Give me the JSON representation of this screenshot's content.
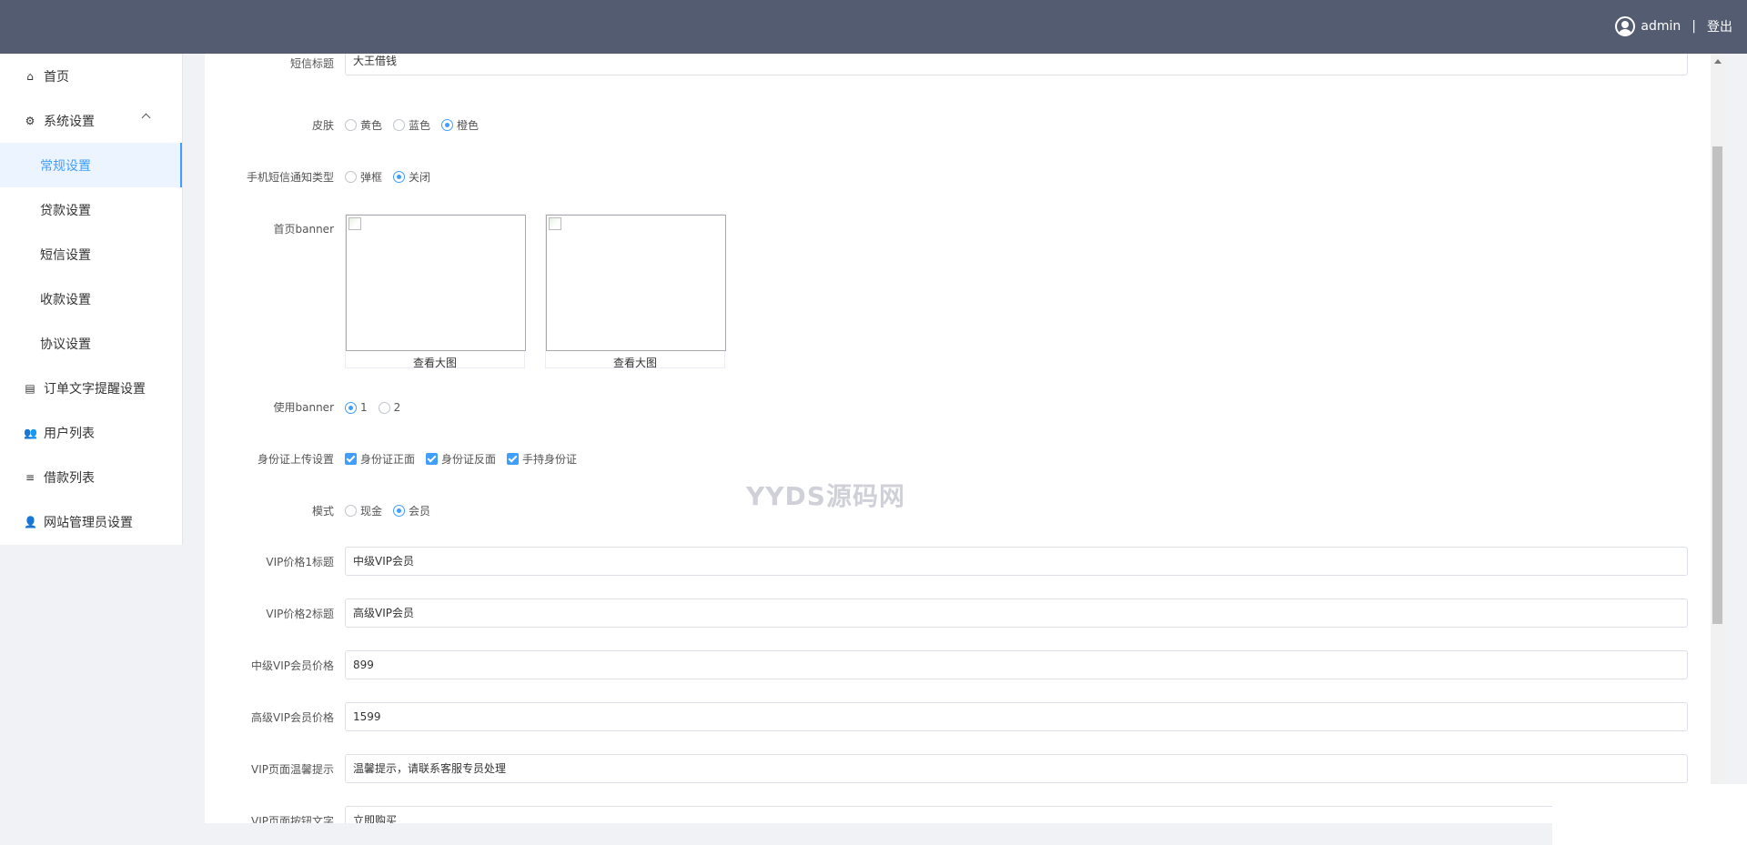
{
  "header": {
    "username": "admin",
    "separator": "|",
    "logout": "登出"
  },
  "sidebar": {
    "items": [
      {
        "label": "首页",
        "icon": "home-icon"
      },
      {
        "label": "系统设置",
        "icon": "gear-icon",
        "expanded": true,
        "children": [
          {
            "label": "常规设置",
            "active": true
          },
          {
            "label": "贷款设置"
          },
          {
            "label": "短信设置"
          },
          {
            "label": "收款设置"
          },
          {
            "label": "协议设置"
          }
        ]
      },
      {
        "label": "订单文字提醒设置",
        "icon": "list-icon"
      },
      {
        "label": "用户列表",
        "icon": "users-icon"
      },
      {
        "label": "借款列表",
        "icon": "lines-icon"
      },
      {
        "label": "网站管理员设置",
        "icon": "user-icon"
      }
    ]
  },
  "form": {
    "top_partial": {
      "label": "短信标题",
      "value": "大王借钱"
    },
    "skin": {
      "label": "皮肤",
      "options": [
        "黄色",
        "蓝色",
        "橙色"
      ],
      "selected": "橙色"
    },
    "sms_type": {
      "label": "手机短信通知类型",
      "options": [
        "弹框",
        "关闭"
      ],
      "selected": "关闭"
    },
    "banner": {
      "label": "首页banner",
      "view_label": "查看大图"
    },
    "use_banner": {
      "label": "使用banner",
      "options": [
        "1",
        "2"
      ],
      "selected": "1"
    },
    "id_upload": {
      "label": "身份证上传设置",
      "options": [
        "身份证正面",
        "身份证反面",
        "手持身份证"
      ],
      "checked": [
        "身份证正面",
        "身份证反面",
        "手持身份证"
      ]
    },
    "mode": {
      "label": "模式",
      "options": [
        "现金",
        "会员"
      ],
      "selected": "会员"
    },
    "vip1_title": {
      "label": "VIP价格1标题",
      "value": "中级VIP会员"
    },
    "vip2_title": {
      "label": "VIP价格2标题",
      "value": "高级VIP会员"
    },
    "mid_vip_price": {
      "label": "中级VIP会员价格",
      "value": "899"
    },
    "high_vip_price": {
      "label": "高级VIP会员价格",
      "value": "1599"
    },
    "vip_tip": {
      "label": "VIP页面温馨提示",
      "value": "温馨提示，请联系客服专员处理"
    },
    "vip_button": {
      "label": "VIP页面按钮文字",
      "value": "立即购买"
    }
  },
  "watermark": "YYDS源码网",
  "colors": {
    "header_bg": "#545c71",
    "accent": "#409eff",
    "active_bg": "#ecf5ff"
  }
}
